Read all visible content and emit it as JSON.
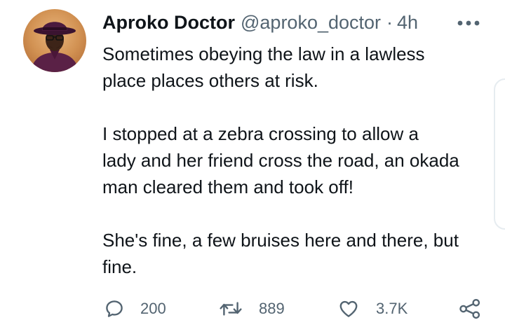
{
  "tweet": {
    "author": {
      "display_name": "Aproko Doctor",
      "handle": "@aproko_doctor",
      "avatar_icon": "user-avatar"
    },
    "separator": "·",
    "timestamp": "4h",
    "more_icon": "more-horizontal-icon",
    "text_paragraphs": [
      [
        "Sometimes obeying the law in a lawless",
        "place places others at risk."
      ],
      [
        "I stopped at a zebra crossing to allow a",
        "lady and her friend cross the road, an okada",
        "man cleared them and took off!"
      ],
      [
        "She's fine, a few bruises here and there, but",
        "fine."
      ]
    ],
    "actions": {
      "reply": {
        "icon": "reply-icon",
        "count": "200"
      },
      "retweet": {
        "icon": "retweet-icon",
        "count": "889"
      },
      "like": {
        "icon": "heart-icon",
        "count": "3.7K"
      },
      "share": {
        "icon": "share-icon"
      }
    }
  },
  "colors": {
    "text_primary": "#0f1419",
    "text_secondary": "#536471",
    "background": "#ffffff"
  }
}
